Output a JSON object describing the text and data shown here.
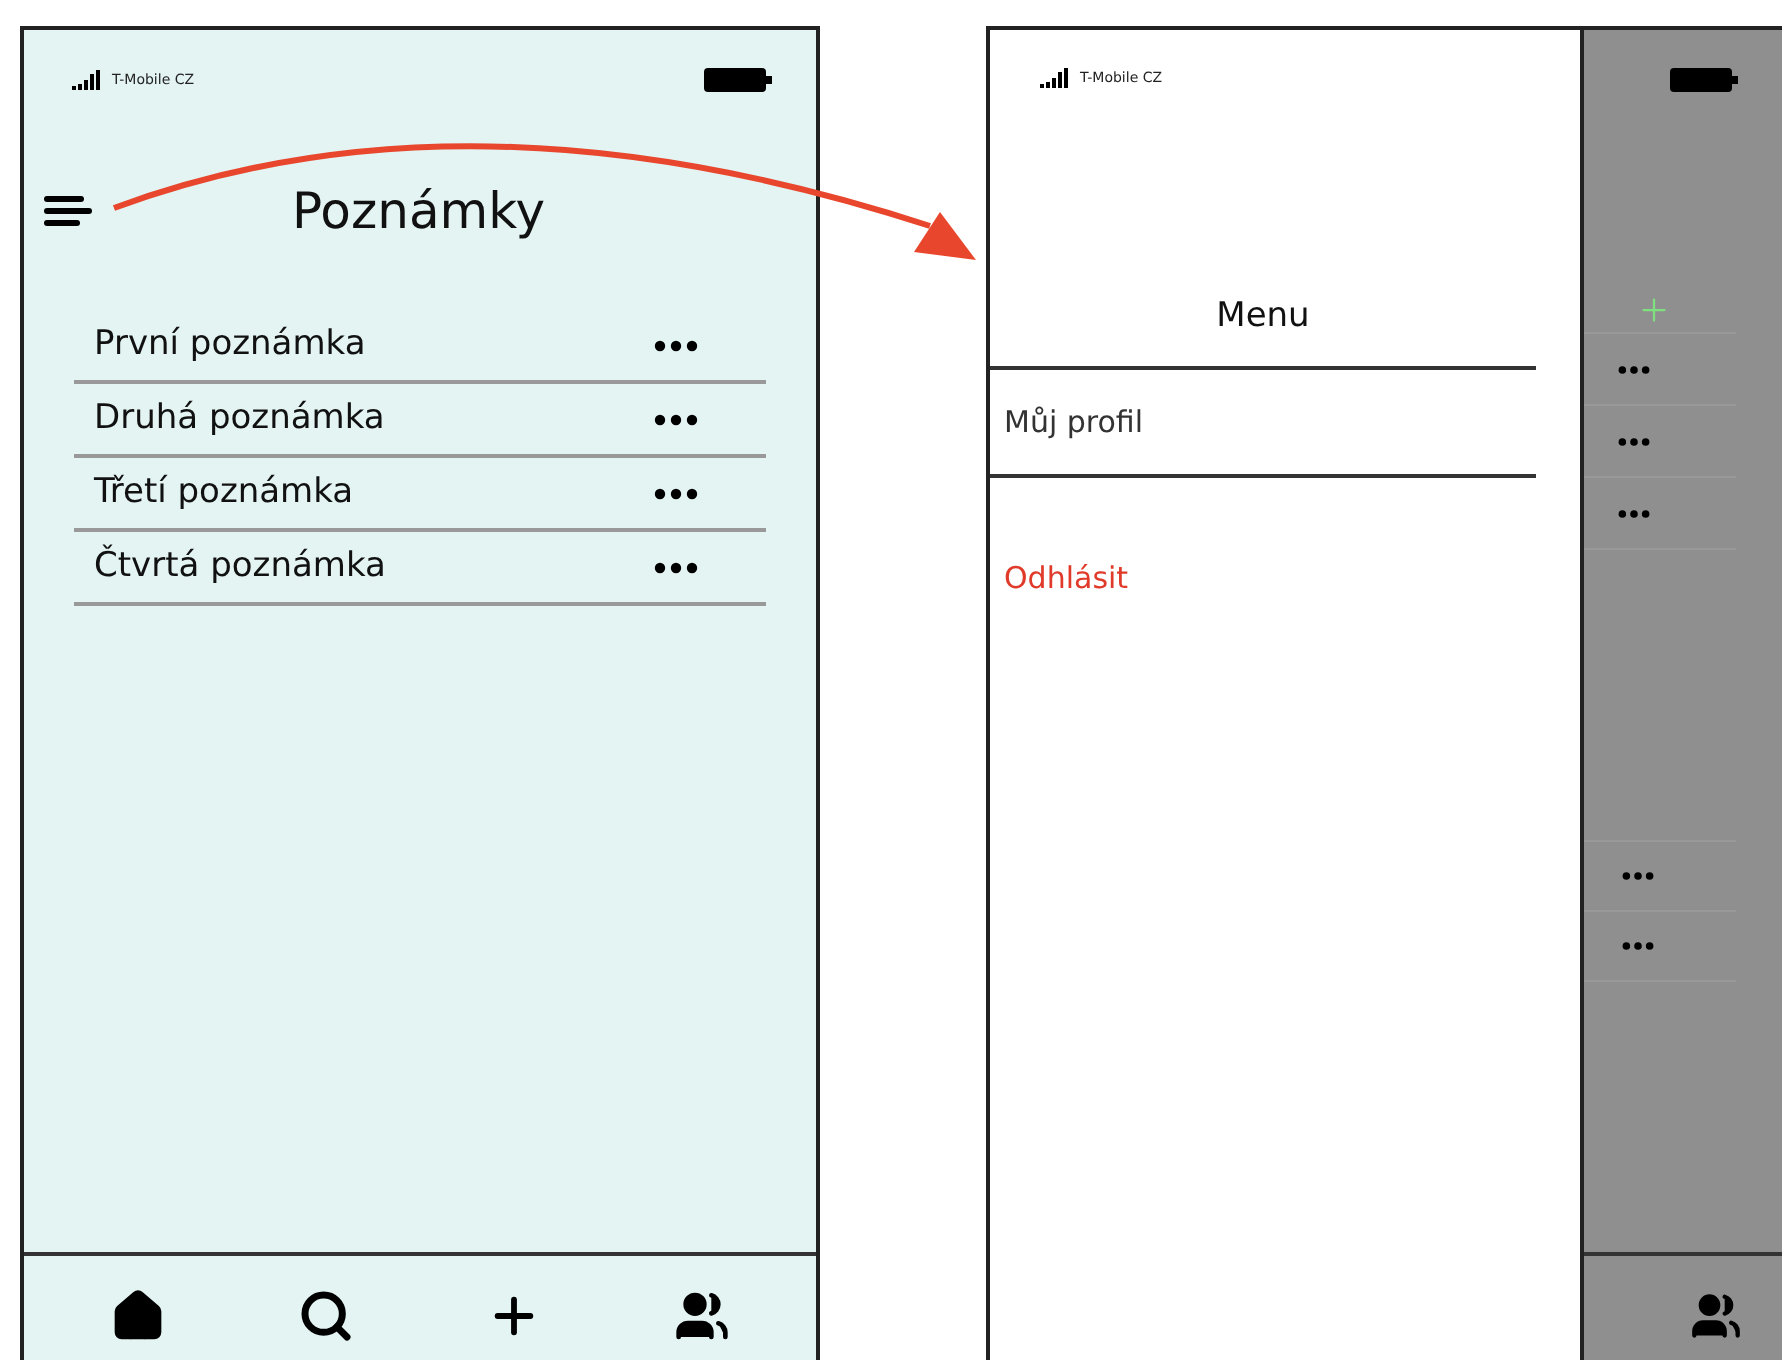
{
  "notes_screen": {
    "carrier": "T-Mobile CZ",
    "title": "Poznámky",
    "notes": [
      {
        "title": "První poznámka"
      },
      {
        "title": "Druhá poznámka"
      },
      {
        "title": "Třetí poznámka"
      },
      {
        "title": "Čtvrtá poznámka"
      }
    ]
  },
  "menu_screen": {
    "carrier": "T-Mobile CZ",
    "title": "Menu",
    "items": [
      {
        "label": "Můj profil",
        "kind": "normal"
      },
      {
        "label": "Odhlásit",
        "kind": "danger"
      }
    ]
  }
}
